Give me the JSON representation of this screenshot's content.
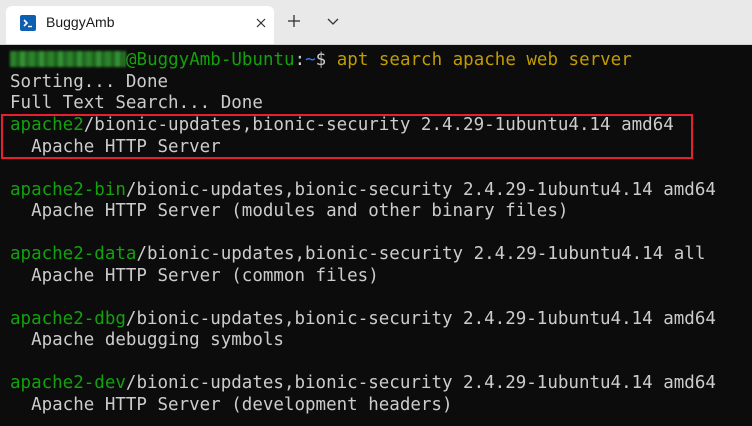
{
  "tab": {
    "title": "BuggyAmb",
    "icon": "terminal-icon",
    "close_icon": "close-icon"
  },
  "toolbar": {
    "new_tab_icon": "plus-icon",
    "dropdown_icon": "chevron-down-icon"
  },
  "prompt": {
    "user": "",
    "host": "@BuggyAmb-Ubuntu",
    "separator": ":",
    "path": "~",
    "symbol": "$ ",
    "command": "apt search apache web server"
  },
  "status_lines": [
    "Sorting... Done",
    "Full Text Search... Done"
  ],
  "packages": [
    {
      "name": "apache2",
      "details": "/bionic-updates,bionic-security 2.4.29-1ubuntu4.14 amd64",
      "description": "  Apache HTTP Server"
    },
    {
      "name": "apache2-bin",
      "details": "/bionic-updates,bionic-security 2.4.29-1ubuntu4.14 amd64",
      "description": "  Apache HTTP Server (modules and other binary files)"
    },
    {
      "name": "apache2-data",
      "details": "/bionic-updates,bionic-security 2.4.29-1ubuntu4.14 all",
      "description": "  Apache HTTP Server (common files)"
    },
    {
      "name": "apache2-dbg",
      "details": "/bionic-updates,bionic-security 2.4.29-1ubuntu4.14 amd64",
      "description": "  Apache debugging symbols"
    },
    {
      "name": "apache2-dev",
      "details": "/bionic-updates,bionic-security 2.4.29-1ubuntu4.14 amd64",
      "description": "  Apache HTTP Server (development headers)"
    }
  ],
  "colors": {
    "background": "#0c0c0c",
    "text": "#cccccc",
    "package_name": "#13a10e",
    "host": "#13a10e",
    "path": "#3b78ff",
    "command": "#c19c00",
    "highlight": "#e6202f"
  }
}
